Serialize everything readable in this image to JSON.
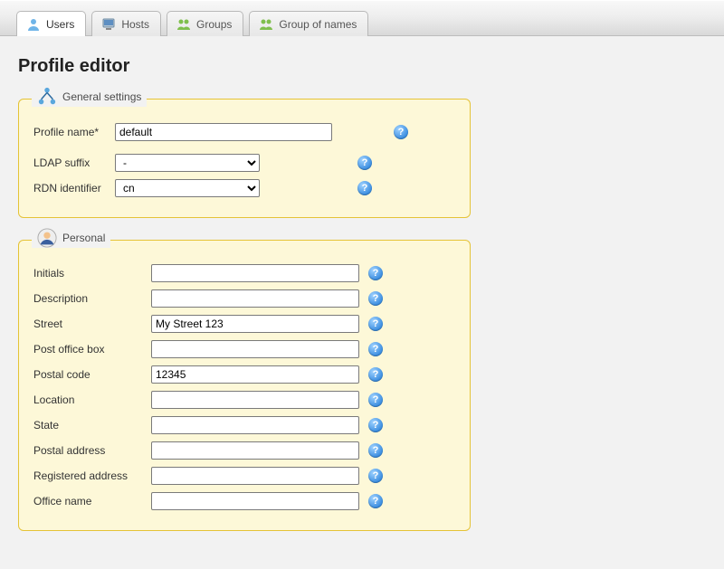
{
  "tabs": [
    {
      "label": "Users",
      "icon": "user-icon"
    },
    {
      "label": "Hosts",
      "icon": "host-icon"
    },
    {
      "label": "Groups",
      "icon": "group-icon"
    },
    {
      "label": "Group of names",
      "icon": "group-icon"
    }
  ],
  "page_title": "Profile editor",
  "general": {
    "legend": "General settings",
    "profile_name_label": "Profile name*",
    "profile_name_value": "default",
    "ldap_suffix_label": "LDAP suffix",
    "ldap_suffix_selected": "-",
    "rdn_label": "RDN identifier",
    "rdn_selected": "cn"
  },
  "personal": {
    "legend": "Personal",
    "fields": [
      {
        "label": "Initials",
        "value": ""
      },
      {
        "label": "Description",
        "value": ""
      },
      {
        "label": "Street",
        "value": "My Street 123"
      },
      {
        "label": "Post office box",
        "value": ""
      },
      {
        "label": "Postal code",
        "value": "12345"
      },
      {
        "label": "Location",
        "value": ""
      },
      {
        "label": "State",
        "value": ""
      },
      {
        "label": "Postal address",
        "value": ""
      },
      {
        "label": "Registered address",
        "value": ""
      },
      {
        "label": "Office name",
        "value": ""
      }
    ]
  }
}
